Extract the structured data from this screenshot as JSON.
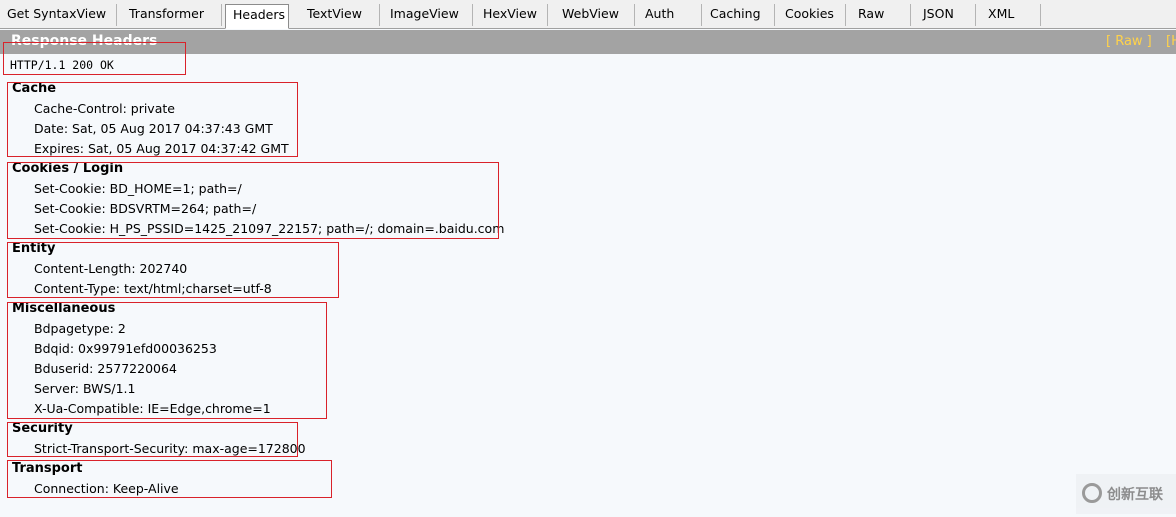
{
  "tabs": [
    {
      "label": "Get SyntaxView"
    },
    {
      "label": "Transformer"
    },
    {
      "label": "Headers",
      "active": true
    },
    {
      "label": "TextView"
    },
    {
      "label": "ImageView"
    },
    {
      "label": "HexView"
    },
    {
      "label": "WebView"
    },
    {
      "label": "Auth"
    },
    {
      "label": "Caching"
    },
    {
      "label": "Cookies"
    },
    {
      "label": "Raw"
    },
    {
      "label": "JSON"
    },
    {
      "label": "XML"
    }
  ],
  "header": {
    "title": "Response Headers",
    "raw_link": "[ Raw ]",
    "header_definitions_link": "[H"
  },
  "status_line": "HTTP/1.1 200 OK",
  "groups": {
    "cache": {
      "title": "Cache",
      "lines": [
        "Cache-Control: private",
        "Date: Sat, 05 Aug 2017 04:37:43 GMT",
        "Expires: Sat, 05 Aug 2017 04:37:42 GMT"
      ]
    },
    "cookies": {
      "title": "Cookies / Login",
      "lines": [
        "Set-Cookie: BD_HOME=1; path=/",
        "Set-Cookie: BDSVRTM=264; path=/",
        "Set-Cookie: H_PS_PSSID=1425_21097_22157; path=/; domain=.baidu.com"
      ]
    },
    "entity": {
      "title": "Entity",
      "lines": [
        "Content-Length: 202740",
        "Content-Type: text/html;charset=utf-8"
      ]
    },
    "misc": {
      "title": "Miscellaneous",
      "lines": [
        "Bdpagetype: 2",
        "Bdqid: 0x99791efd00036253",
        "Bduserid: 2577220064",
        "Server: BWS/1.1",
        "X-Ua-Compatible: IE=Edge,chrome=1"
      ]
    },
    "security": {
      "title": "Security",
      "lines": [
        "Strict-Transport-Security: max-age=172800"
      ]
    },
    "transport": {
      "title": "Transport",
      "lines": [
        "Connection: Keep-Alive"
      ]
    }
  },
  "watermark": {
    "text": "创新互联"
  },
  "colors": {
    "annotation_box": "#d9222a",
    "header_bg": "#a3a3a3",
    "link": "#ffd24a"
  }
}
